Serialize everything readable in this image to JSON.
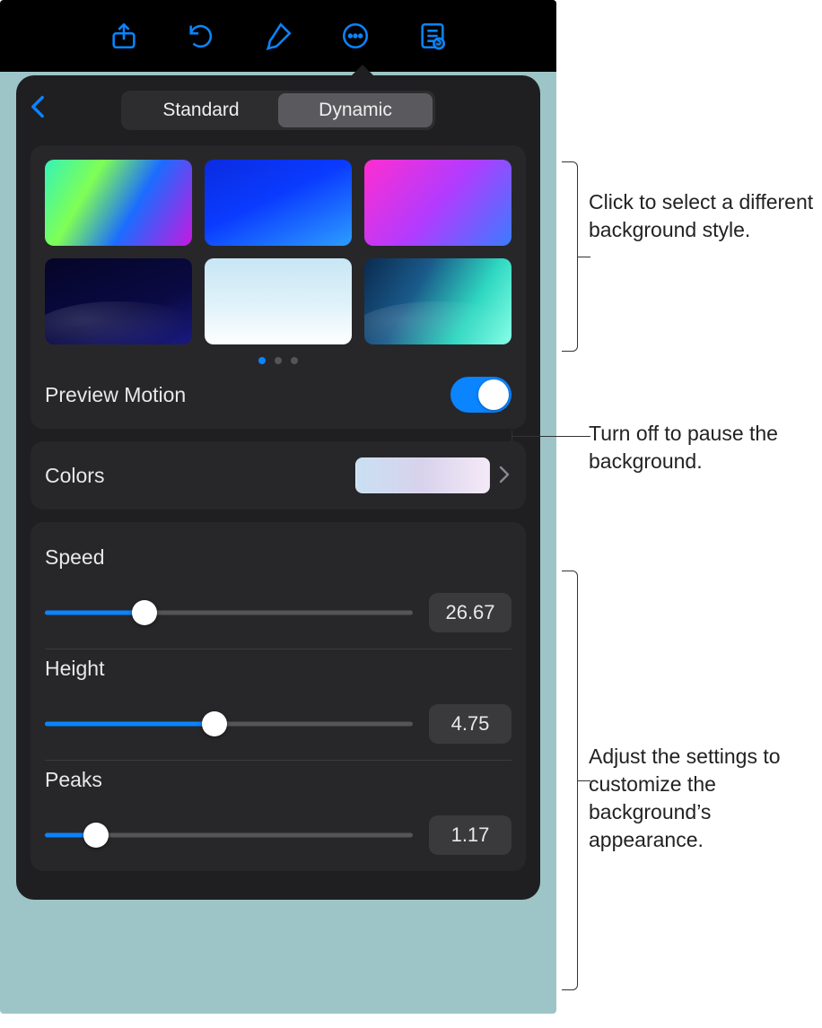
{
  "toolbar": {
    "icons": [
      "share-icon",
      "undo-icon",
      "format-brush-icon",
      "more-icon",
      "presenter-notes-icon"
    ]
  },
  "panel": {
    "tabs": {
      "standard": "Standard",
      "dynamic": "Dynamic",
      "active": "dynamic"
    },
    "preview_motion": {
      "label": "Preview Motion",
      "on": true
    },
    "colors": {
      "label": "Colors"
    },
    "sliders": {
      "speed": {
        "label": "Speed",
        "value": "26.67",
        "percent": 27
      },
      "height": {
        "label": "Height",
        "value": "4.75",
        "percent": 46
      },
      "peaks": {
        "label": "Peaks",
        "value": "1.17",
        "percent": 14
      }
    },
    "page_dots": {
      "count": 3,
      "active": 0
    }
  },
  "annotations": {
    "styles": "Click to select a different background style.",
    "motion": "Turn off to pause the background.",
    "sliders": "Adjust the settings to customize the background’s appearance."
  }
}
